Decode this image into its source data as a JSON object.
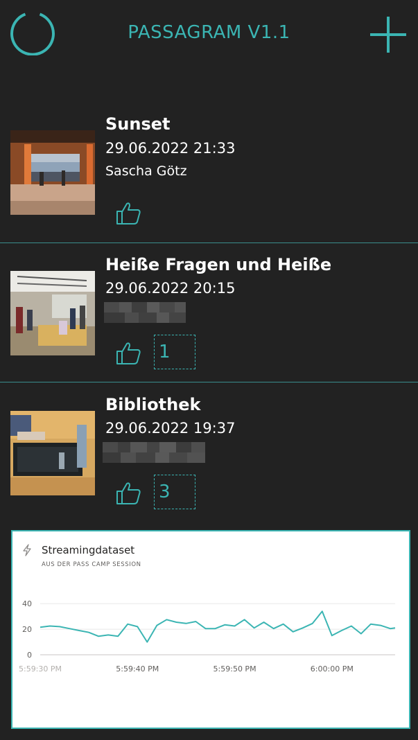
{
  "app": {
    "title": "PASSAGRAM V1.1",
    "accent_color": "#3bb5b3",
    "background_color": "#222222",
    "refresh_icon": "refresh-icon",
    "add_icon": "plus-icon"
  },
  "posts": [
    {
      "title": "Sunset",
      "datetime": "29.06.2022 21:33",
      "author": "Sascha Götz",
      "author_blurred": false,
      "likes": "",
      "like_icon": "thumbs-up-icon"
    },
    {
      "title": "Heiße Fragen und Heiße",
      "datetime": "29.06.2022 20:15",
      "author": "",
      "author_blurred": true,
      "likes": "1",
      "like_icon": "thumbs-up-icon"
    },
    {
      "title": "Bibliothek",
      "datetime": "29.06.2022 19:37",
      "author": "",
      "author_blurred": true,
      "likes": "3",
      "like_icon": "thumbs-up-icon"
    }
  ],
  "chart_data": {
    "type": "line",
    "title": "Streamingdataset",
    "subtitle": "AUS DER PASS CAMP SESSION",
    "xlabel": "",
    "ylabel": "",
    "ylim": [
      0,
      45
    ],
    "yticks": [
      "40",
      "20",
      "0"
    ],
    "ytick_values": [
      40,
      20,
      0
    ],
    "xticks": [
      "5:59:30 PM",
      "5:59:40 PM",
      "5:59:50 PM",
      "6:00:00 PM"
    ],
    "xtick_seconds": [
      0,
      10,
      20,
      30
    ],
    "xlim_seconds": [
      0,
      36.5
    ],
    "grid": true,
    "line_color": "#3bb5b3",
    "series": [
      {
        "values": [
          [
            0,
            21.5
          ],
          [
            1,
            22.5
          ],
          [
            2,
            22
          ],
          [
            3,
            20.5
          ],
          [
            4,
            19
          ],
          [
            5,
            17.5
          ],
          [
            6,
            14.5
          ],
          [
            7,
            15.5
          ],
          [
            8,
            14.5
          ],
          [
            9,
            24
          ],
          [
            10,
            22
          ],
          [
            11,
            10
          ],
          [
            12,
            23
          ],
          [
            13,
            27.5
          ],
          [
            14,
            25.5
          ],
          [
            15,
            24.5
          ],
          [
            16,
            26
          ],
          [
            17,
            20.5
          ],
          [
            18,
            20.5
          ],
          [
            19,
            23.5
          ],
          [
            20,
            22.5
          ],
          [
            21,
            27.5
          ],
          [
            22,
            21
          ],
          [
            23,
            25.5
          ],
          [
            24,
            20.5
          ],
          [
            25,
            24
          ],
          [
            26,
            18
          ],
          [
            27,
            21
          ],
          [
            28,
            24.5
          ],
          [
            29,
            34
          ],
          [
            30,
            15
          ],
          [
            31,
            19
          ],
          [
            32,
            22.5
          ],
          [
            33,
            16.5
          ],
          [
            34,
            24
          ],
          [
            35,
            23
          ],
          [
            36,
            20.5
          ],
          [
            36.5,
            21
          ]
        ]
      }
    ]
  }
}
